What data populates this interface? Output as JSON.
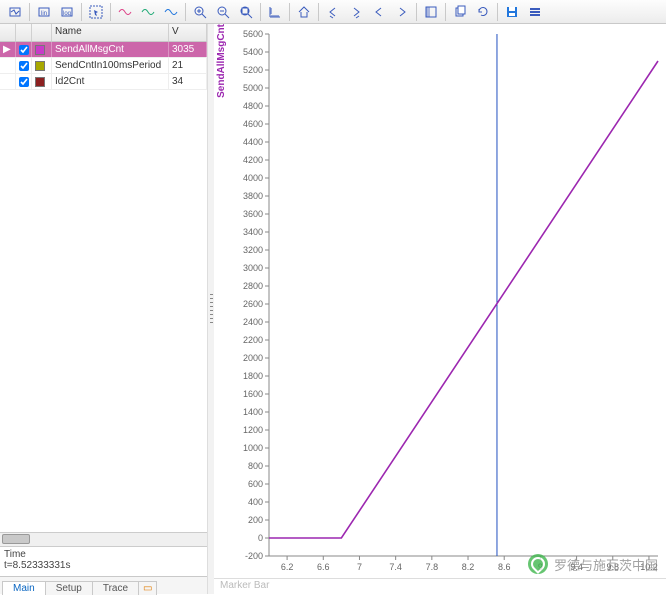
{
  "toolbar": {
    "buttons": [
      {
        "name": "scope-icon",
        "glyph": "scope"
      },
      {
        "name": "linear-axis-icon",
        "glyph": "lin"
      },
      {
        "name": "log-axis-icon",
        "glyph": "log"
      },
      {
        "name": "cursor-icon",
        "glyph": "cursor"
      },
      {
        "name": "wave-a-icon",
        "glyph": "wavea"
      },
      {
        "name": "wave-b-icon",
        "glyph": "waveb"
      },
      {
        "name": "wave-c-icon",
        "glyph": "wavec"
      },
      {
        "name": "zoom-in-icon",
        "glyph": "zoomin"
      },
      {
        "name": "zoom-out-icon",
        "glyph": "zoomout"
      },
      {
        "name": "zoom-fit-icon",
        "glyph": "zoomfit"
      },
      {
        "name": "ruler-xy-icon",
        "glyph": "rulerxy"
      },
      {
        "name": "home-icon",
        "glyph": "home"
      },
      {
        "name": "nav-prev-down-icon",
        "glyph": "navpd"
      },
      {
        "name": "nav-next-down-icon",
        "glyph": "navnd"
      },
      {
        "name": "nav-prev-icon",
        "glyph": "navp"
      },
      {
        "name": "nav-next-icon",
        "glyph": "navn"
      },
      {
        "name": "panel-icon",
        "glyph": "panel"
      },
      {
        "name": "copy-icon",
        "glyph": "copy"
      },
      {
        "name": "refresh-icon",
        "glyph": "refresh"
      },
      {
        "name": "save-icon",
        "glyph": "save"
      },
      {
        "name": "settings-icon",
        "glyph": "settings"
      }
    ]
  },
  "signalTable": {
    "headers": {
      "name": "Name",
      "value": "V"
    },
    "rows": [
      {
        "checked": true,
        "color": "#c83cc8",
        "name": "SendAllMsgCnt",
        "value": "3035",
        "selected": true
      },
      {
        "checked": true,
        "color": "#a8a800",
        "name": "SendCntIn100msPeriod",
        "value": "21",
        "selected": false
      },
      {
        "checked": true,
        "color": "#8c2020",
        "name": "Id2Cnt",
        "value": "34",
        "selected": false
      }
    ]
  },
  "info": {
    "line1": "Time",
    "line2": "t=8.52333331s"
  },
  "tabs": {
    "items": [
      {
        "label": "Main",
        "active": true
      },
      {
        "label": "Setup",
        "active": false
      },
      {
        "label": "Trace",
        "active": false
      }
    ]
  },
  "markerBar": "Marker Bar",
  "watermark": "罗德与施瓦茨中国",
  "chart_data": {
    "type": "line",
    "title": "",
    "xlabel": "",
    "ylabel": "SendAllMsgCnt",
    "xlim": [
      6.0,
      10.3
    ],
    "ylim": [
      -200,
      5600
    ],
    "xticks": [
      6.2,
      6.6,
      7,
      7.4,
      7.8,
      8.2,
      8.6,
      9,
      9.4,
      9.8,
      10.2
    ],
    "yticks": [
      -200,
      0,
      200,
      400,
      600,
      800,
      1000,
      1200,
      1400,
      1600,
      1800,
      2000,
      2200,
      2400,
      2600,
      2800,
      3000,
      3200,
      3400,
      3600,
      3800,
      4000,
      4200,
      4400,
      4600,
      4800,
      5000,
      5200,
      5400,
      5600
    ],
    "cursor_x": 8.52,
    "series": [
      {
        "name": "SendAllMsgCnt",
        "color": "#9c27b0",
        "x": [
          6.0,
          6.8,
          10.3
        ],
        "y": [
          0,
          0,
          5300
        ]
      }
    ]
  }
}
